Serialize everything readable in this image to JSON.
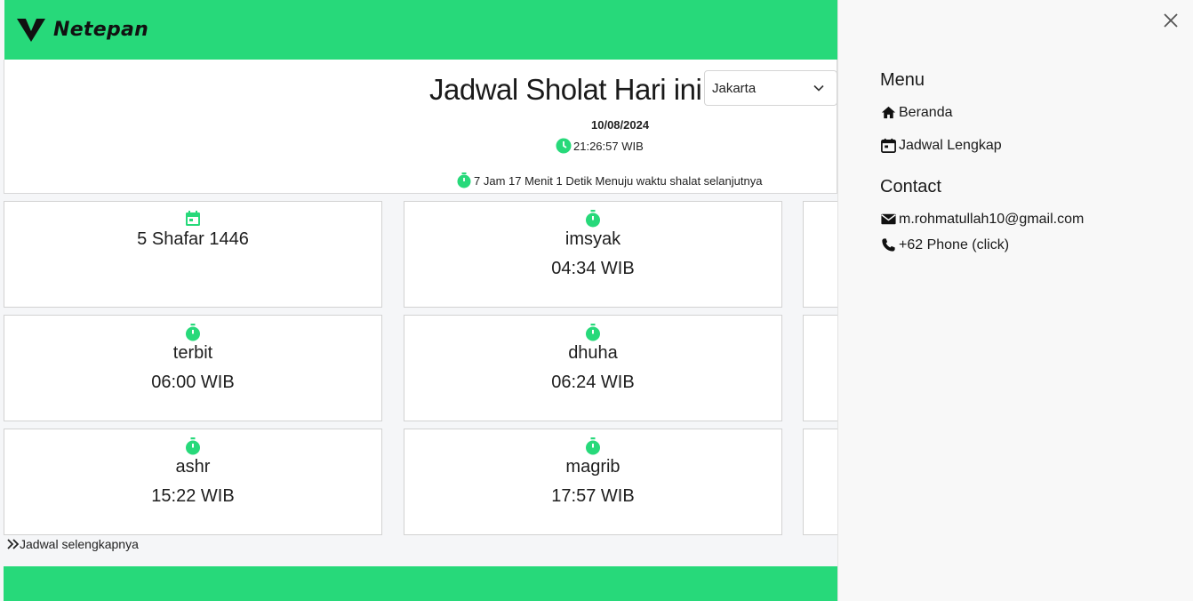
{
  "brand": {
    "name": "Netepan",
    "accent": "#27d97a"
  },
  "header": {
    "title": "Jadwal Sholat Hari ini",
    "city_selected": "Jakarta",
    "date": "10/08/2024",
    "clock": "21:26:57 WIB",
    "countdown": "7 Jam 17 Menit 1 Detik Menuju waktu shalat selanjutnya"
  },
  "cards": [
    {
      "icon": "calendar-icon",
      "name": "5 Shafar 1446",
      "time": ""
    },
    {
      "icon": "timer-icon",
      "name": "imsyak",
      "time": "04:34 WIB"
    },
    {
      "icon": "timer-icon",
      "name": "terbit",
      "time": "06:00 WIB"
    },
    {
      "icon": "timer-icon",
      "name": "dhuha",
      "time": "06:24 WIB"
    },
    {
      "icon": "timer-icon",
      "name": "ashr",
      "time": "15:22 WIB"
    },
    {
      "icon": "timer-icon",
      "name": "magrib",
      "time": "17:57 WIB"
    }
  ],
  "more_link": "Jadwal selengkapnya",
  "sidebar": {
    "menu_heading": "Menu",
    "menu_items": [
      {
        "icon": "home-icon",
        "label": "Beranda"
      },
      {
        "icon": "calendar-icon",
        "label": "Jadwal Lengkap"
      }
    ],
    "contact_heading": "Contact",
    "contact_items": [
      {
        "icon": "mail-icon",
        "label": "m.rohmatullah10@gmail.com"
      },
      {
        "icon": "phone-icon",
        "label": "+62 Phone (click)"
      }
    ]
  }
}
